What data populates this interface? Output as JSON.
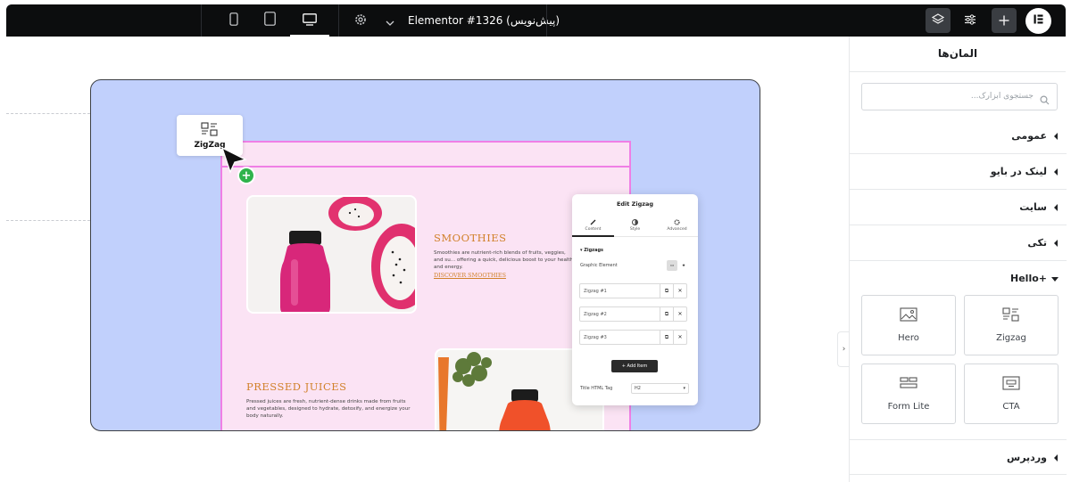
{
  "topbar": {
    "document_title": "Elementor #1326 (پیش‌نویس)",
    "devices": [
      {
        "name": "mobile",
        "icon": "mobile-icon"
      },
      {
        "name": "tablet",
        "icon": "tablet-icon"
      },
      {
        "name": "desktop",
        "icon": "desktop-icon",
        "active": true
      }
    ]
  },
  "canvas": {
    "background_color": "#c1d0fc",
    "page_color": "#fbe3f4",
    "selection_color": "#ef7fe5",
    "dragged_widget_label": "ZigZag",
    "section1": {
      "title": "SMOOTHIES",
      "body": "Smoothies are nutrient-rich blends of fruits, veggies, and su... offering a quick, delicious boost to your health and energy.",
      "link": "DISCOVER SMOOTHIES"
    },
    "section2": {
      "title": "PRESSED JUICES",
      "body": "Pressed juices are fresh, nutrient-dense drinks made from fruits and vegetables, designed to hydrate, detoxify, and energize your body naturally."
    }
  },
  "edit_panel": {
    "title": "Edit Zigzag",
    "tabs": [
      {
        "label": "Content",
        "active": true
      },
      {
        "label": "Style"
      },
      {
        "label": "Advanced"
      }
    ],
    "section_label": "Zigzags",
    "graphic_element_label": "Graphic Element",
    "items": [
      "Zigzag #1",
      "Zigzag #2",
      "Zigzag #3"
    ],
    "add_item_label": "+ Add Item",
    "title_tag_label": "Title HTML Tag",
    "title_tag_value": "H2"
  },
  "sidebar": {
    "title": "المان‌ها",
    "search_placeholder": "جستجوی ابزارک...",
    "categories": [
      "عمومی",
      "لینک در بایو",
      "سایت",
      "تکی"
    ],
    "hello_category": "Hello+",
    "widgets": [
      {
        "label": "Zigzag",
        "icon": "zigzag-icon"
      },
      {
        "label": "Hero",
        "icon": "hero-image-icon"
      },
      {
        "label": "CTA",
        "icon": "cta-icon"
      },
      {
        "label": "Form Lite",
        "icon": "form-icon"
      }
    ],
    "footer_category": "وردپرس"
  }
}
